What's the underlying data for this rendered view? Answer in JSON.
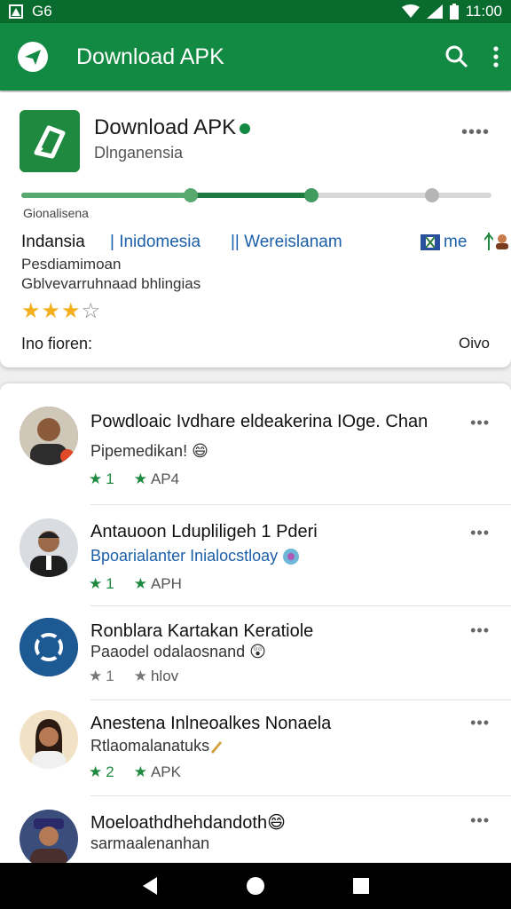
{
  "status_bar": {
    "left_text": "G6",
    "time": "11:00"
  },
  "app_bar": {
    "title": "Download APK"
  },
  "app": {
    "name": "Download APK",
    "developer": "Dlnganensia",
    "progress_fraction": 0.62,
    "progress_label": "Gionalisena",
    "languages": [
      "Indansia",
      "| Inidomesia",
      "|| Wereislanam",
      "me"
    ],
    "description_line1": "Pesdiamimoan",
    "description_line2": "Gblvevarruhnaad bhlingias",
    "rating": 3,
    "rating_max": 4,
    "info_label": "Ino fioren:",
    "info_value": "Oivo"
  },
  "list": [
    {
      "title": "Powdloaic Ivdhare eldeakerina IOge. Chan",
      "subtitle": "Pipemedikan!",
      "subtitle_color": "#333333",
      "meta1": "1",
      "meta2": "AP4",
      "emoji": "😄"
    },
    {
      "title": "Antauoon Ldupliligeh 1 Pderi",
      "subtitle": "Bpoarialanter Inialocstloay",
      "subtitle_color": "#1c5fa8",
      "meta1": "1",
      "meta2": "APH",
      "emoji": ""
    },
    {
      "title": "Ronblara Kartakan Keratiole",
      "subtitle": "Paaodel odalaosnand",
      "subtitle_color": "#333333",
      "meta1": "1",
      "meta2": "hlov",
      "emoji": "😲"
    },
    {
      "title": "Anestena Inlneoalkes Nonaela",
      "subtitle": "Rtlaomalanatuks",
      "subtitle_color": "#333333",
      "meta1": "2",
      "meta2": "APK",
      "emoji": ""
    },
    {
      "title": "Moeloathdhehdandoth",
      "subtitle": "sarmaalenanhan",
      "subtitle_color": "#333333",
      "meta1": "",
      "meta2": "",
      "emoji": "😄"
    }
  ],
  "colors": {
    "primary": "#138a43",
    "status_bar": "#0a6b2f",
    "link": "#1c5fa8",
    "star": "#f2b01e"
  }
}
